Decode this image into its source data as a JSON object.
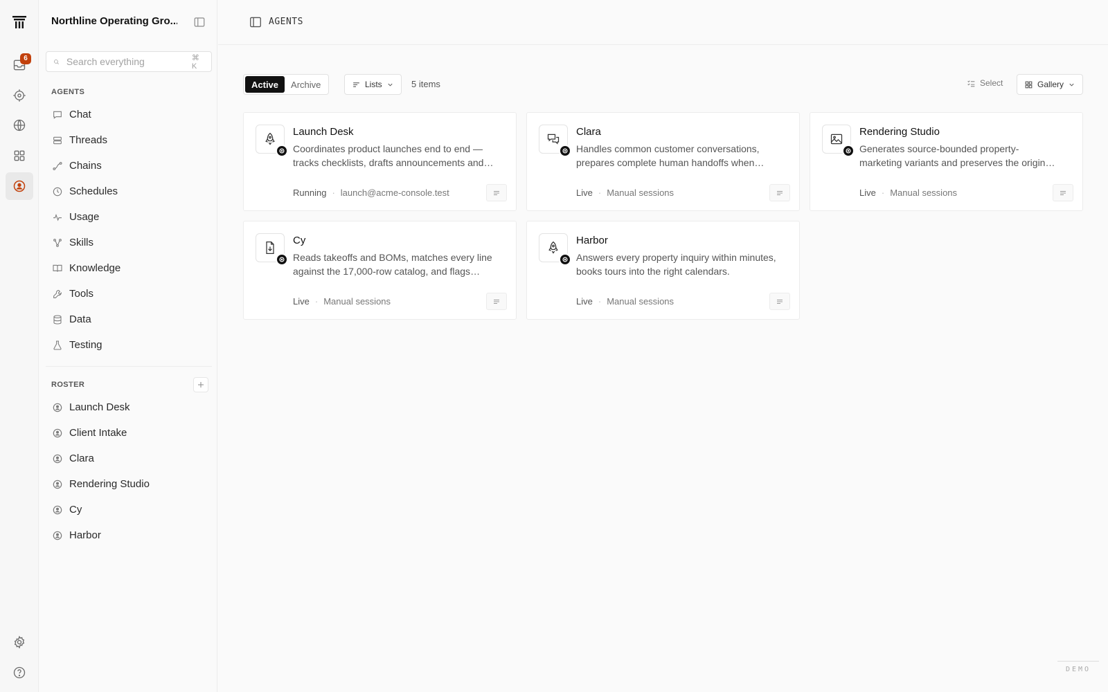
{
  "rail": {
    "inbox_badge": "6"
  },
  "sidebar": {
    "org_name": "Northline Operating Gro...",
    "search": {
      "placeholder": "Search everything",
      "shortcut": "⌘ K"
    },
    "agents_title": "AGENTS",
    "agents_items": [
      {
        "label": "Chat",
        "icon": "chat-icon"
      },
      {
        "label": "Threads",
        "icon": "threads-icon"
      },
      {
        "label": "Chains",
        "icon": "chains-icon"
      },
      {
        "label": "Schedules",
        "icon": "clock-icon"
      },
      {
        "label": "Usage",
        "icon": "activity-icon"
      },
      {
        "label": "Skills",
        "icon": "skills-icon"
      },
      {
        "label": "Knowledge",
        "icon": "book-icon"
      },
      {
        "label": "Tools",
        "icon": "wrench-icon"
      },
      {
        "label": "Data",
        "icon": "database-icon"
      },
      {
        "label": "Testing",
        "icon": "flask-icon"
      }
    ],
    "roster_title": "ROSTER",
    "roster_items": [
      {
        "label": "Launch Desk"
      },
      {
        "label": "Client Intake"
      },
      {
        "label": "Clara"
      },
      {
        "label": "Rendering Studio"
      },
      {
        "label": "Cy"
      },
      {
        "label": "Harbor"
      }
    ]
  },
  "header": {
    "breadcrumb": "AGENTS"
  },
  "toolbar": {
    "tab_active": "Active",
    "tab_archive": "Archive",
    "lists_label": "Lists",
    "count": "5 items",
    "select_label": "Select",
    "view_label": "Gallery"
  },
  "cards": [
    {
      "title": "Launch Desk",
      "desc": "Coordinates product launches end to end — tracks checklists, drafts announcements and keeps owners on schedule.",
      "status": "Running",
      "sub": "launch@acme-console.test",
      "icon": "rocket-icon"
    },
    {
      "title": "Clara",
      "desc": "Handles common customer conversations, prepares complete human handoffs when needed.",
      "status": "Live",
      "sub": "Manual sessions",
      "icon": "chat-bubbles-icon"
    },
    {
      "title": "Rendering Studio",
      "desc": "Generates source-bounded property-marketing variants and preserves the original assets.",
      "status": "Live",
      "sub": "Manual sessions",
      "icon": "image-icon"
    },
    {
      "title": "Cy",
      "desc": "Reads takeoffs and BOMs, matches every line against the 17,000-row catalog, and flags gaps.",
      "status": "Live",
      "sub": "Manual sessions",
      "icon": "file-download-icon"
    },
    {
      "title": "Harbor",
      "desc": "Answers every property inquiry within minutes, books tours into the right calendars.",
      "status": "Live",
      "sub": "Manual sessions",
      "icon": "rocket-icon"
    }
  ],
  "footer": {
    "demo": "DEMO"
  }
}
